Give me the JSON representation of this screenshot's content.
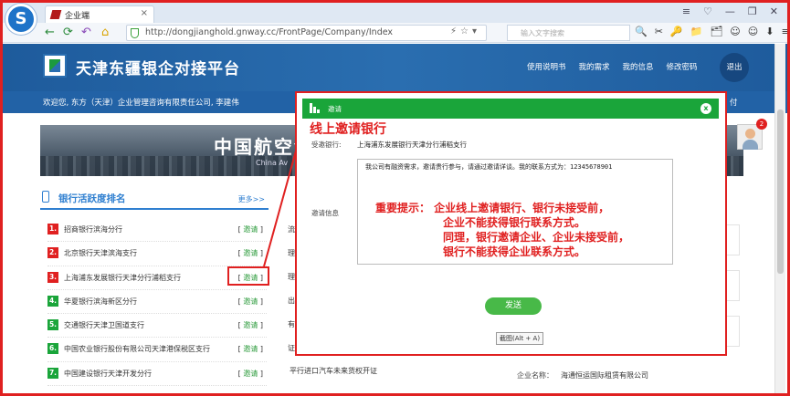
{
  "browser": {
    "tab_title": "企业端",
    "tab_close": "×",
    "window_controls": [
      "≡",
      "♡",
      "—",
      "❐",
      "✕"
    ],
    "nav_icons": [
      "←",
      "⟳",
      "↶",
      "⌂"
    ],
    "url": "http://dongjianghold.gnway.cc/FrontPage/Company/Index",
    "url_right_icons": "⚡☆▾",
    "search_placeholder": "输入文字搜索",
    "toolbar_icons": [
      "🔍",
      "✂",
      "🔑",
      "📁",
      "🗂",
      "☺",
      "☺",
      "⬇",
      "≡"
    ]
  },
  "site": {
    "title": "天津东疆银企对接平台",
    "nav": [
      "使用说明书",
      "我的需求",
      "我的信息",
      "修改密码"
    ],
    "logout": "退出",
    "welcome": "欢迎您, 东方（天津）企业管理咨询有限责任公司, 李建伟",
    "welcome_right": "付",
    "banner_title": "中国航空金",
    "banner_sub": "China Av",
    "avatar_badge": "2"
  },
  "ranking": {
    "title": "银行活跃度排名",
    "more": "更多>>",
    "invite_bracket_left": "[ ",
    "invite_label": "邀请",
    "invite_bracket_right": " ]",
    "items": [
      {
        "num": "1.",
        "name": "招商银行滨海分行",
        "color": "#e02020"
      },
      {
        "num": "2.",
        "name": "北京银行天津滨海支行",
        "color": "#e02020"
      },
      {
        "num": "3.",
        "name": "上海浦东发展银行天津分行浦稻支行",
        "color": "#e02020"
      },
      {
        "num": "4.",
        "name": "华夏银行滨海新区分行",
        "color": "#1aa53a"
      },
      {
        "num": "5.",
        "name": "交通银行天津卫国道支行",
        "color": "#1aa53a"
      },
      {
        "num": "6.",
        "name": "中国农业银行股份有限公司天津港保税区支行",
        "color": "#1aa53a"
      },
      {
        "num": "7.",
        "name": "中国建设银行天津开发分行",
        "color": "#1aa53a"
      }
    ]
  },
  "middle": {
    "rows": [
      "流",
      "理",
      "理",
      "出",
      "有",
      "证"
    ],
    "bottom_text": "平行进口汽车未来货权开证"
  },
  "right": {
    "company_label": "企业名称：",
    "company_value": "海通恒运国际租赁有限公司"
  },
  "modal": {
    "header_title": "邀请",
    "close_label": "x",
    "heading": "线上邀请银行",
    "bank_label": "受邀银行:",
    "bank_value": "上海浦东发展银行天津分行浦稻支行",
    "message_label": "邀请信息",
    "message_text": "我公司有融资需求，邀请贵行参与，请通过邀请详谈。我的联系方式为：12345678901",
    "notice_lines": [
      "重要提示： 企业线上邀请银行、银行未接受前，",
      "企业不能获得银行联系方式。",
      "同理，银行邀请企业、企业未接受前，",
      "银行不能获得企业联系方式。"
    ],
    "send_label": "发送",
    "screenshot_tip": "截图(Alt + A)"
  },
  "colors": {
    "accent_red": "#e02020",
    "header_green": "#1aa53a",
    "site_blue": "#2262a6"
  }
}
